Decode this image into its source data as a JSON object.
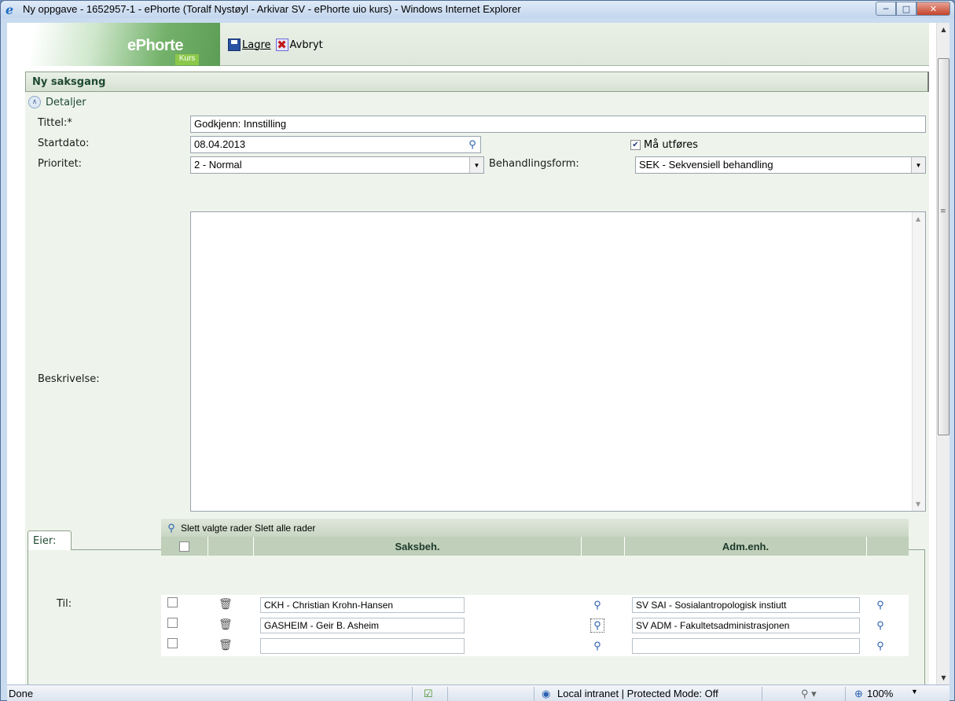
{
  "window": {
    "title": "Ny oppgave - 1652957-1 - ePhorte (Toralf Nystøyl - Arkivar SV - ePhorte uio kurs) - Windows Internet Explorer",
    "icon": "ie-icon",
    "controls": [
      "minimize",
      "maximize",
      "close"
    ]
  },
  "logo": {
    "name": "ePhorte",
    "sub": "Kurs"
  },
  "toolbar": {
    "save_label": "Lagre",
    "cancel_label": "Avbryt"
  },
  "section": {
    "title": "Ny saksgang"
  },
  "details": {
    "label": "Detaljer"
  },
  "form": {
    "tittel_label": "Tittel:*",
    "tittel_value": "Godkjenn: Innstilling",
    "startdato_label": "Startdato:",
    "startdato_value": "08.04.2013",
    "ma_utfores_label": "Må utføres",
    "ma_utfores_checked": true,
    "prioritet_label": "Prioritet:",
    "prioritet_value": "2 - Normal",
    "behandlingsform_label": "Behandlingsform:",
    "behandlingsform_value": "SEK - Sekvensiell behandling",
    "beskrivelse_label": "Beskrivelse:",
    "beskrivelse_value": ""
  },
  "tabs": {
    "eier": "Eier:"
  },
  "grid": {
    "til_label": "Til:",
    "toolbar_text": "Slett valgte rader Slett alle rader",
    "columns": [
      "Saksbeh.",
      "Adm.enh."
    ],
    "rows": [
      {
        "saksbeh": "CKH - Christian Krohn-Hansen",
        "admenh": "SV SAI - Sosialantropologisk instiutt"
      },
      {
        "saksbeh": "GASHEIM - Geir B. Asheim",
        "admenh": "SV ADM - Fakultetsadministrasjonen"
      },
      {
        "saksbeh": "",
        "admenh": ""
      }
    ]
  },
  "statusbar": {
    "left": "Done",
    "zone": "Local intranet | Protected Mode: Off",
    "zoom": "100%"
  }
}
